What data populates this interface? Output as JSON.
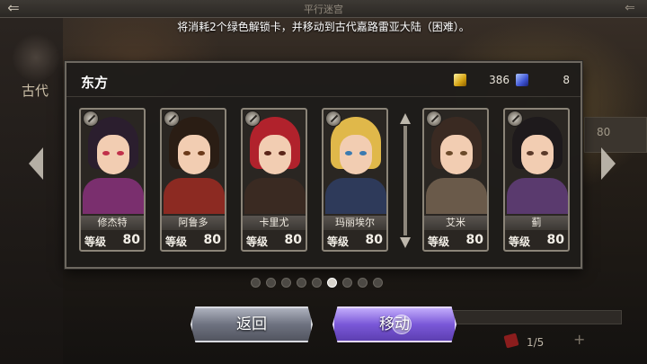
{
  "topbar": {
    "title": "平行迷宫",
    "back_symbol": "⇐",
    "right_symbol": "⇐"
  },
  "notice": "将消耗2个绿色解锁卡，并移动到古代嘉路雷亚大陆（困难）。",
  "background": {
    "left_label": "古代",
    "right_value": "80",
    "page_count": "1/5",
    "plus_symbol": "+"
  },
  "dialog": {
    "region_title": "东方",
    "resources": [
      {
        "icon": "gold-key-icon",
        "value": "386"
      },
      {
        "icon": "blue-key-icon",
        "value": "8"
      }
    ]
  },
  "party": {
    "level_label": "等级",
    "members": [
      {
        "name": "修杰特",
        "level": "80",
        "hair": "#2b1e2e",
        "body": "#7a2f6e",
        "eye": "#c0304a"
      },
      {
        "name": "阿鲁多",
        "level": "80",
        "hair": "#2a1d14",
        "body": "#8c2a22",
        "eye": "#6b3a1a"
      },
      {
        "name": "卡里尤",
        "level": "80",
        "hair": "#b1222c",
        "body": "#3a2a22",
        "eye": "#5a2418"
      },
      {
        "name": "玛丽埃尔",
        "level": "80",
        "hair": "#e0b84a",
        "body": "#2e3a5a",
        "eye": "#3a7ab0"
      },
      {
        "name": "艾米",
        "level": "80",
        "hair": "#3a2a22",
        "body": "#6a5a4a",
        "eye": "#6b4a2a"
      },
      {
        "name": "蓟",
        "level": "80",
        "hair": "#1e1a1c",
        "body": "#5a3a6e",
        "eye": "#5a3a2a"
      }
    ]
  },
  "pager": {
    "count": 9,
    "active_index": 5
  },
  "buttons": {
    "back_label": "返回",
    "move_label": "移动"
  },
  "colors": {
    "accent_purple": "#7a58d8",
    "button_gray": "#6e7280",
    "gold": "#d4a212",
    "blue": "#3f55d4"
  }
}
